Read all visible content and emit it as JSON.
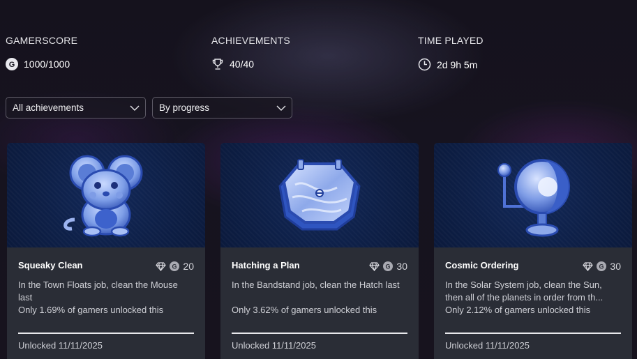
{
  "stats": {
    "gamerscore": {
      "label": "GAMERSCORE",
      "value": "1000/1000",
      "icon": "gamerscore-g-icon"
    },
    "achievements": {
      "label": "ACHIEVEMENTS",
      "value": "40/40",
      "icon": "trophy-icon"
    },
    "time_played": {
      "label": "TIME PLAYED",
      "value": "2d 9h 5m",
      "icon": "clock-icon"
    }
  },
  "filters": {
    "filter_select": {
      "value": "All achievements"
    },
    "sort_select": {
      "value": "By progress"
    }
  },
  "cards": [
    {
      "title": "Squeaky Clean",
      "score": "20",
      "description": "In the Town Floats job, clean the Mouse last",
      "rarity": "Only 1.69% of gamers unlocked this",
      "unlocked": "Unlocked 11/11/2025",
      "art": "mouse-art"
    },
    {
      "title": "Hatching a Plan",
      "score": "30",
      "description": "In the Bandstand job, clean the Hatch last",
      "rarity": "Only 3.62% of gamers unlocked this",
      "unlocked": "Unlocked 11/11/2025",
      "art": "hatch-art"
    },
    {
      "title": "Cosmic Ordering",
      "score": "30",
      "description": "In the Solar System job, clean the Sun, then all of the planets in order from th...",
      "rarity": "Only 2.12% of gamers unlocked this",
      "unlocked": "Unlocked 11/11/2025",
      "art": "orrery-art"
    }
  ],
  "colors": {
    "background": "#16131f",
    "card": "#2a2d36",
    "art_blue": "#0e2048",
    "icon_blue": "#3b64c8"
  }
}
